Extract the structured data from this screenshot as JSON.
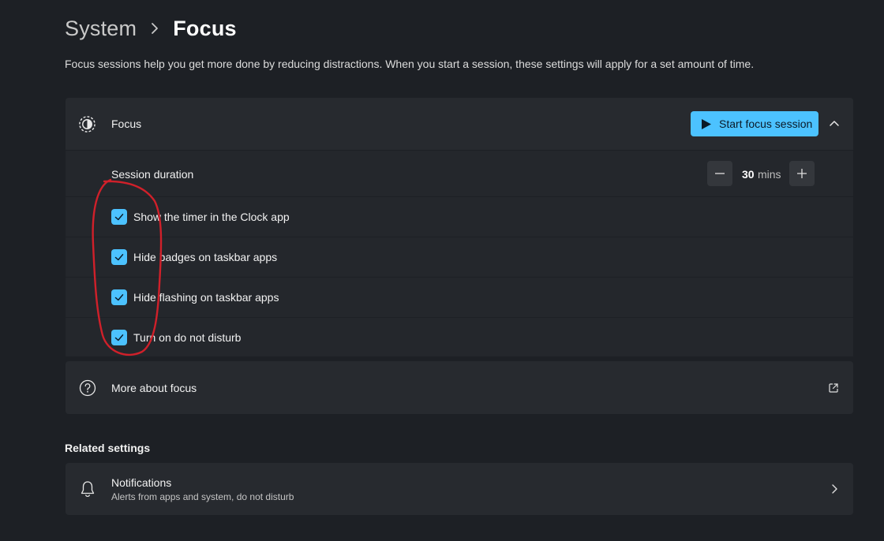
{
  "breadcrumb": {
    "parent": "System",
    "current": "Focus"
  },
  "description": "Focus sessions help you get more done by reducing distractions. When you start a session, these settings will apply for a set amount of time.",
  "focus": {
    "title": "Focus",
    "icon": "focus-icon",
    "start_button": "Start focus session",
    "expanded": true,
    "session_duration": {
      "label": "Session duration",
      "value": "30",
      "unit": "mins"
    },
    "options": [
      {
        "label": "Show the timer in the Clock app",
        "checked": true
      },
      {
        "label": "Hide badges on taskbar apps",
        "checked": true
      },
      {
        "label": "Hide flashing on taskbar apps",
        "checked": true
      },
      {
        "label": "Turn on do not disturb",
        "checked": true
      }
    ]
  },
  "more_about": {
    "label": "More about focus",
    "icon": "help-icon"
  },
  "related": {
    "title": "Related settings",
    "items": [
      {
        "label": "Notifications",
        "description": "Alerts from apps and system, do not disturb",
        "icon": "bell-icon"
      }
    ]
  },
  "colors": {
    "accent": "#4cc2ff",
    "background": "#1d2025",
    "card": "#272a2f",
    "annotation": "#d0202a"
  }
}
